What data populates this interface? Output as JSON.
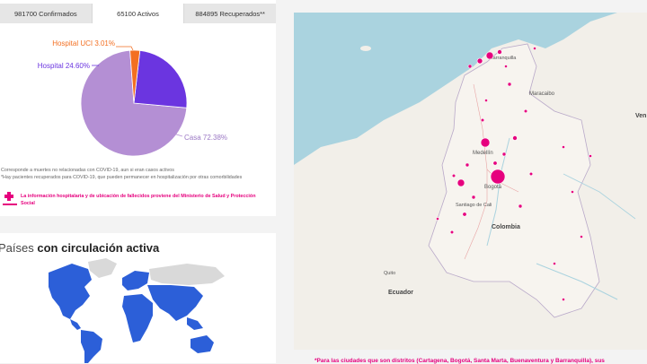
{
  "tabs": [
    {
      "label": "981700 Confirmados",
      "active": false
    },
    {
      "label": "65100 Activos",
      "active": true
    },
    {
      "label": "884895 Recuperados**",
      "active": false
    }
  ],
  "pie": {
    "slices": [
      {
        "label": "Casa 72.38%",
        "value": 72.38,
        "color": "#b48fd4"
      },
      {
        "label": "Hospital 24.60%",
        "value": 24.6,
        "color": "#6b35e0"
      },
      {
        "label": "Hospital UCI 3.01%",
        "value": 3.01,
        "color": "#f36f21"
      }
    ]
  },
  "notes": {
    "line1": "Corresponde a muertes no relacionadas con COVID-19, aun si eran casos activos",
    "line2": "*Hay pacientes recuperados para COVID-19, que pueden permanecer en hospitalización por otras comorbilidades"
  },
  "source": {
    "text": "La información hospitalaria y de ubicación de fallecidos proviene del Ministerio de Salud y Protección Social",
    "color": "#e6007e"
  },
  "countries": {
    "title_light": "Países ",
    "title_bold": "con circulación activa"
  },
  "map": {
    "labels": {
      "venezuela": "Ven",
      "colombia": "Colombia",
      "ecuador": "Ecuador",
      "medellin": "Medellín",
      "bogota": "Bogotá",
      "cali": "Santiago de Cali",
      "barranquilla": "Barranquilla",
      "maracaibo": "Maracaibo",
      "quito": "Quito"
    },
    "note": "*Para las ciudades que son distritos (Cartagena, Bogotá, Santa Marta, Buenaventura y Barranquilla), sus"
  }
}
